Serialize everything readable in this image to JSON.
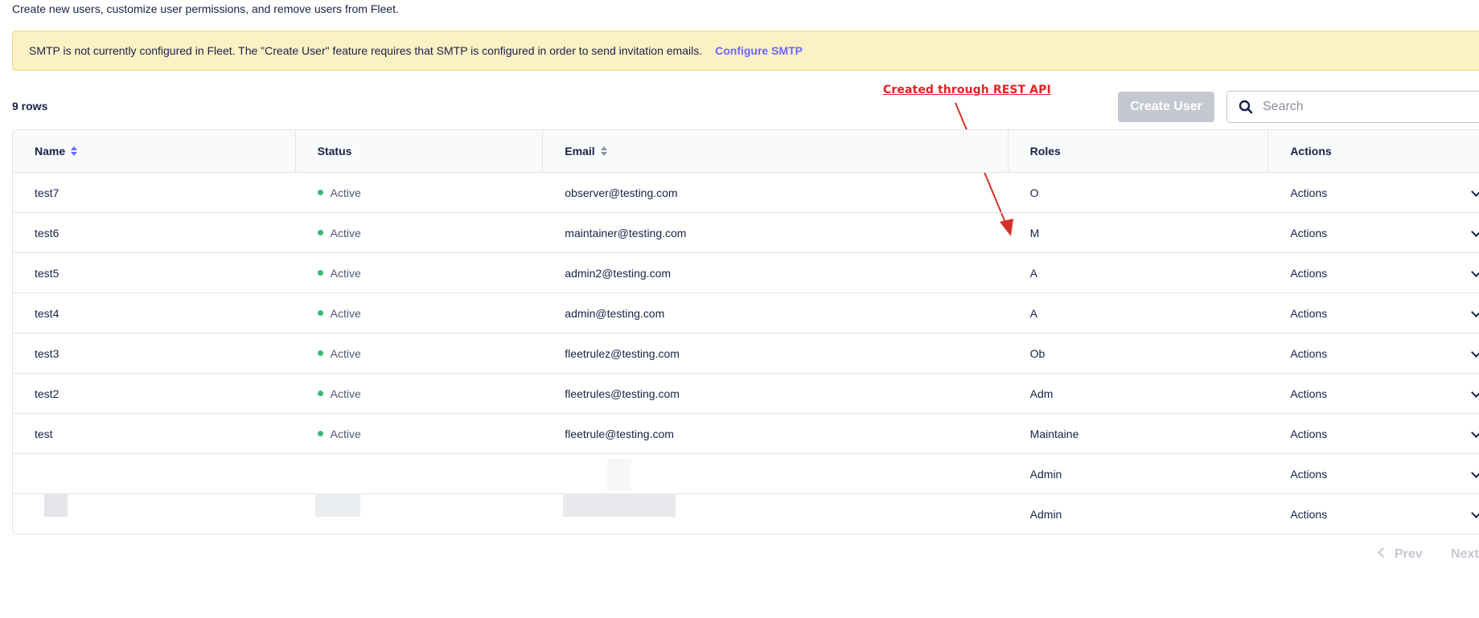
{
  "intro_text": "Create new users, customize user permissions, and remove users from Fleet.",
  "banner": {
    "message": "SMTP is not currently configured in Fleet. The \"Create User\" feature requires that SMTP is configured in order to send invitation emails.",
    "link_label": "Configure SMTP"
  },
  "row_count": "9 rows",
  "annotation": "Created through REST API",
  "toolbar": {
    "create_label": "Create User",
    "search_placeholder": "Search"
  },
  "table": {
    "headers": {
      "name": "Name",
      "status": "Status",
      "email": "Email",
      "roles": "Roles",
      "actions": "Actions"
    },
    "rows": [
      {
        "name": "test7",
        "status": "Active",
        "email": "observer@testing.com",
        "role": "O",
        "actions": "Actions"
      },
      {
        "name": "test6",
        "status": "Active",
        "email": "maintainer@testing.com",
        "role": "M",
        "actions": "Actions"
      },
      {
        "name": "test5",
        "status": "Active",
        "email": "admin2@testing.com",
        "role": "A",
        "actions": "Actions"
      },
      {
        "name": "test4",
        "status": "Active",
        "email": "admin@testing.com",
        "role": "A",
        "actions": "Actions"
      },
      {
        "name": "test3",
        "status": "Active",
        "email": "fleetrulez@testing.com",
        "role": "Ob",
        "actions": "Actions"
      },
      {
        "name": "test2",
        "status": "Active",
        "email": "fleetrules@testing.com",
        "role": "Adm",
        "actions": "Actions"
      },
      {
        "name": "test",
        "status": "Active",
        "email": "fleetrule@testing.com",
        "role": "Maintaine",
        "actions": "Actions"
      },
      {
        "name": "",
        "status": "",
        "email": "",
        "role": "Admin",
        "actions": "Actions"
      },
      {
        "name": "",
        "status": "",
        "email": "",
        "role": "Admin",
        "actions": "Actions"
      }
    ]
  },
  "pagination": {
    "prev_label": "Prev",
    "next_label": "Next"
  },
  "colors": {
    "accent": "#6a67fe",
    "banner_bg": "#fcf1c4",
    "status_active": "#3db67b",
    "annotation": "#e02424"
  }
}
